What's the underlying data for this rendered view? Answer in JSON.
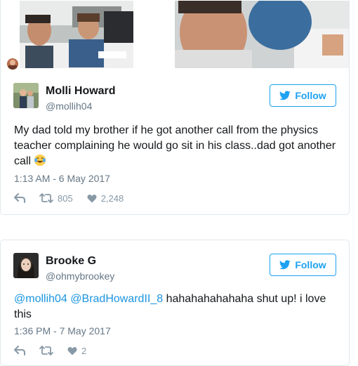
{
  "tweet1": {
    "name": "Molli Howard",
    "handle": "@mollih04",
    "follow_label": "Follow",
    "text": "My dad told my brother if he got another call from the physics teacher complaining he would go sit in his class..dad got another call",
    "emoji": "face-with-tears-of-joy-icon",
    "timestamp": "1:13 AM - 6 May 2017",
    "retweets": "805",
    "likes": "2,248"
  },
  "tweet2": {
    "name": "Brooke G",
    "handle": "@ohmybrookey",
    "follow_label": "Follow",
    "mention1": "@mollih04",
    "mention2": "@BradHowardII_8",
    "text": "hahahahahahaha shut up! i love this",
    "timestamp": "1:36 PM - 7 May 2017",
    "likes": "2"
  },
  "colors": {
    "twitter_blue": "#1da1f2",
    "link": "#1b95e0",
    "muted": "#657786",
    "icon": "#8899a6",
    "border": "#e1e8ed"
  }
}
